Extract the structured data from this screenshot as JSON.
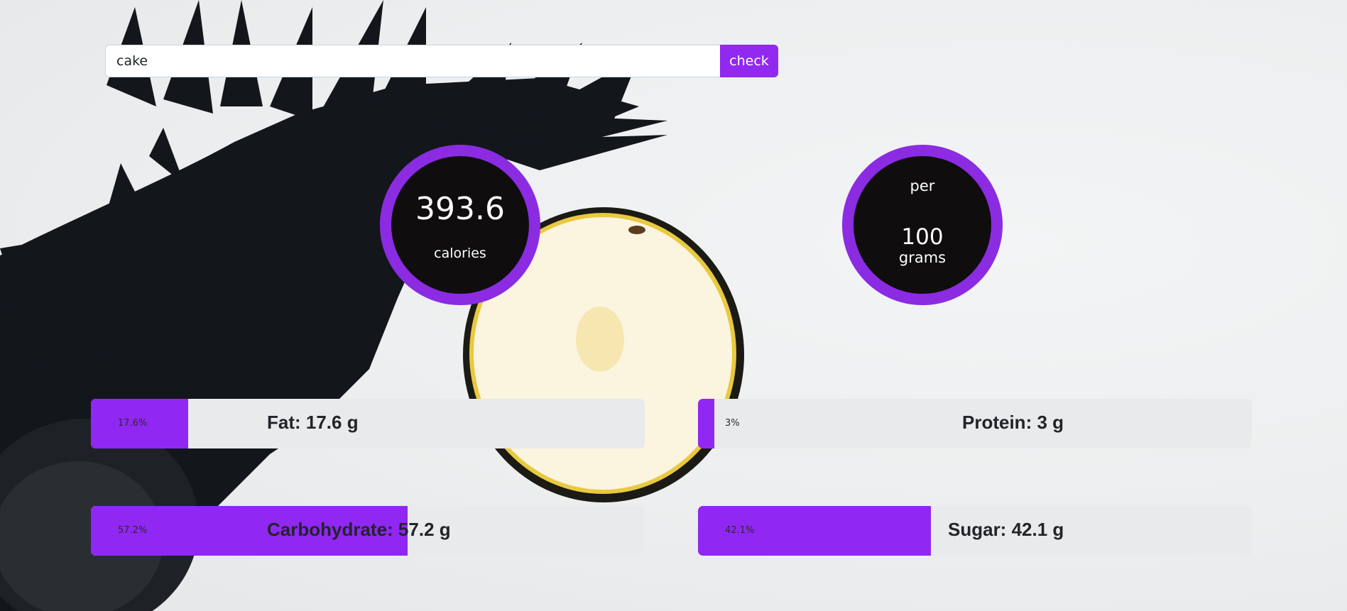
{
  "search": {
    "value": "cake",
    "button_label": "check"
  },
  "calories": {
    "value": "393.6",
    "label": "calories"
  },
  "serving": {
    "per_label": "per",
    "amount": "100",
    "unit": "grams"
  },
  "nutrients": [
    {
      "key": "fat",
      "percent": 17.6,
      "percent_text": "17.6%",
      "label": "Fat: 17.6 g"
    },
    {
      "key": "protein",
      "percent": 3,
      "percent_text": "3%",
      "label": "Protein: 3 g"
    },
    {
      "key": "carbohydrate",
      "percent": 57.2,
      "percent_text": "57.2%",
      "label": "Carbohydrate: 57.2 g"
    },
    {
      "key": "sugar",
      "percent": 42.1,
      "percent_text": "42.1%",
      "label": "Sugar: 42.1 g"
    }
  ],
  "colors": {
    "accent": "#9129f0",
    "ring": "#8b2be2",
    "circle_fill": "#0f0d0d",
    "bar_track": "#e8eaec"
  }
}
